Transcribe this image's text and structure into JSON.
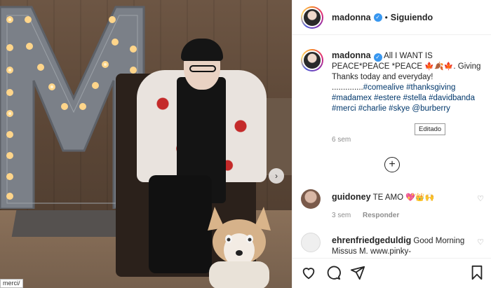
{
  "post": {
    "username": "madonna",
    "follow_status": "Siguiendo",
    "caption_text": "All I WANT IS PEACE*PEACE *PEACE",
    "caption_emojis": "🍁🍂🍁",
    "caption_after": ". Giving Thanks today and everyday! ..............",
    "hashtags_line1": "#comealive #thanksgiving",
    "hashtags_line2": "#madamex #estere #stella",
    "hashtags_line3": "#davidbanda #merci #charlie #skye",
    "mention": "@burberry",
    "edited_tooltip": "Editado",
    "time_ago": "6 sem"
  },
  "comments": [
    {
      "username": "guidoney",
      "text": "TE AMO",
      "emojis": "💖👑🙌",
      "time": "3 sem",
      "reply_label": "Responder"
    },
    {
      "username": "ehrenfriedgeduldig",
      "text": "Good Morning Missus M. www.pinky-",
      "time": "",
      "reply_label": ""
    }
  ],
  "photo": {
    "path_label": "merci/",
    "marquee_letter": "M"
  },
  "icons": [
    "verified-badge-icon",
    "heart-icon",
    "comment-icon",
    "share-icon",
    "bookmark-icon",
    "plus-circle-icon",
    "chevron-right-icon"
  ],
  "colors": {
    "link": "#00376b",
    "verified": "#3897f0",
    "muted": "#8e8e8e",
    "text": "#262626"
  }
}
